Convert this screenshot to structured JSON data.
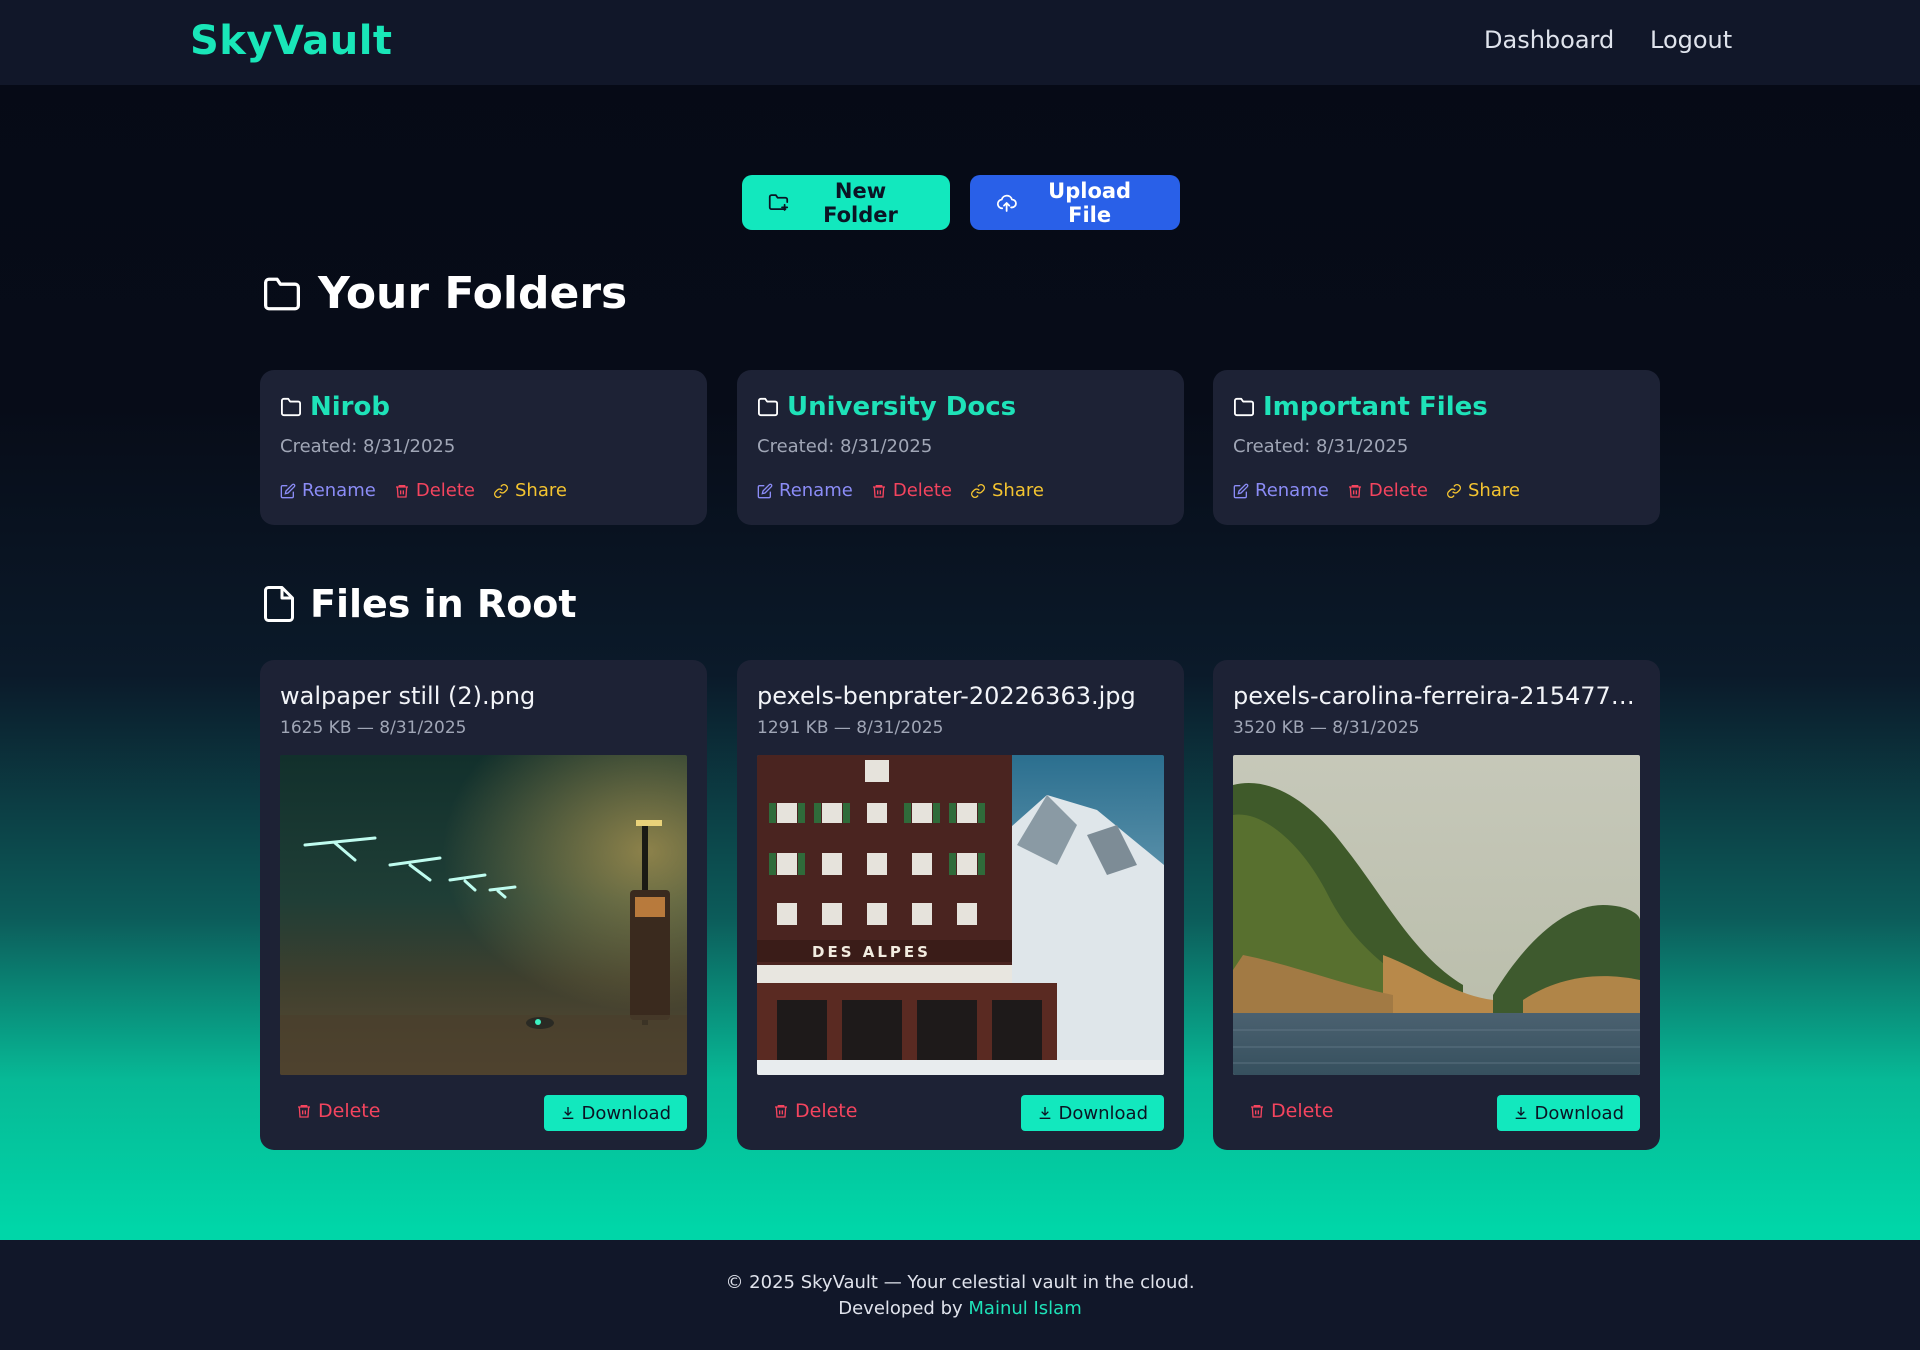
{
  "brand": "SkyVault",
  "nav": {
    "dashboard": "Dashboard",
    "logout": "Logout"
  },
  "actions": {
    "new_folder": "New Folder",
    "upload_file": "Upload File"
  },
  "sections": {
    "folders_title": "Your Folders",
    "files_title": "Files in Root"
  },
  "folders": [
    {
      "name": "Nirob",
      "created": "Created: 8/31/2025"
    },
    {
      "name": "University Docs",
      "created": "Created: 8/31/2025"
    },
    {
      "name": "Important Files",
      "created": "Created: 8/31/2025"
    }
  ],
  "folder_actions": {
    "rename": "Rename",
    "delete": "Delete",
    "share": "Share"
  },
  "files": [
    {
      "name": "walpaper still (2).png",
      "meta": "1625 KB — 8/31/2025"
    },
    {
      "name": "pexels-benprater-20226363.jpg",
      "meta": "1291 KB — 8/31/2025",
      "sign": "DES ALPES"
    },
    {
      "name": "pexels-carolina-ferreira-2154778...",
      "meta": "3520 KB — 8/31/2025"
    }
  ],
  "file_actions": {
    "delete": "Delete",
    "download": "Download"
  },
  "footer": {
    "line1": "© 2025 SkyVault — Your celestial vault in the cloud.",
    "developed_by": "Developed by",
    "author": "Mainul Islam"
  },
  "colors": {
    "accent": "#12e8be",
    "upload": "#2960e8",
    "danger": "#f4445e",
    "rename": "#8b8cf6",
    "share": "#f4c430"
  }
}
